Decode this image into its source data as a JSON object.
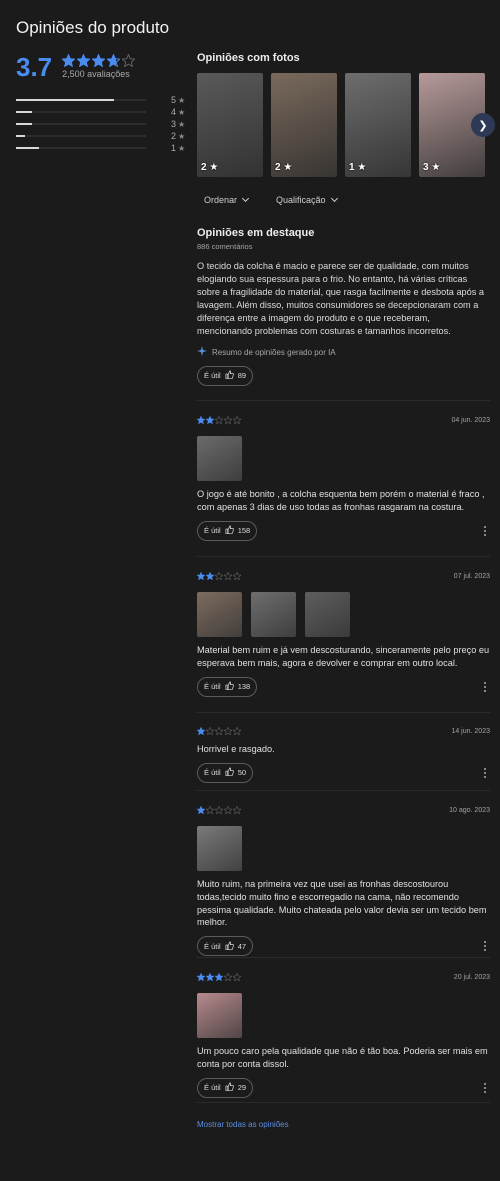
{
  "header": {
    "title": "Opiniões do produto"
  },
  "summary": {
    "average": "3.7",
    "rating": 3.7,
    "total_label": "2,500 avaliações",
    "distribution": [
      {
        "label": "5",
        "fraction": 0.75
      },
      {
        "label": "4",
        "fraction": 0.12
      },
      {
        "label": "3",
        "fraction": 0.12
      },
      {
        "label": "2",
        "fraction": 0.07
      },
      {
        "label": "1",
        "fraction": 0.18
      }
    ]
  },
  "photos_section": {
    "title": "Opiniões com fotos",
    "photos": [
      {
        "rating": "2",
        "tone": "#5a5a5a"
      },
      {
        "rating": "2",
        "tone": "#7a6a5c"
      },
      {
        "rating": "1",
        "tone": "#6e6e6e"
      },
      {
        "rating": "3",
        "tone": "#b79a9a"
      }
    ]
  },
  "filters": {
    "sort_label": "Ordenar",
    "rating_label": "Qualificação"
  },
  "featured": {
    "title": "Opiniões em destaque",
    "comments_count": "886 comentários",
    "ai_summary": "O tecido da colcha é macio e parece ser de qualidade, com muitos elogiando sua espessura para o frio. No entanto, há várias críticas sobre a fragilidade do material, que rasga facilmente e desbota após a lavagem. Além disso, muitos consumidores se decepcionaram com a diferença entre a imagem do produto e o que receberam, mencionando problemas com costuras e tamanhos incorretos.",
    "ai_note": "Resumo de opiniões gerado por IA",
    "useful_label": "É útil",
    "useful_count": "89"
  },
  "reviews": [
    {
      "stars": 2,
      "date": "04 jun. 2023",
      "images": [
        "#6b6b6b"
      ],
      "text": "O jogo é até bonito , a colcha esquenta bem porém o material é fraco , com apenas 3 dias de uso todas as fronhas rasgaram na costura.",
      "useful_label": "É útil",
      "useful_count": "158"
    },
    {
      "stars": 2,
      "date": "07 jul. 2023",
      "images": [
        "#7d6c5f",
        "#6e6e6e",
        "#5e5e5e"
      ],
      "text": "Material bem ruim e já vem descosturando, sinceramente pelo preço eu esperava bem mais, agora e devolver e comprar em outro local.",
      "useful_label": "É útil",
      "useful_count": "138"
    },
    {
      "stars": 1,
      "date": "14 jun. 2023",
      "images": [],
      "text": "Horrivel e rasgado.",
      "useful_label": "É útil",
      "useful_count": "50"
    },
    {
      "stars": 1,
      "date": "10 ago. 2023",
      "images": [
        "#7a7a7a"
      ],
      "text": "Muito ruim, na primeira vez que usei as fronhas descostourou todas,tecido muito fino e escorregadio na cama, não recomendo pessima qualidade. Muito chateada pelo valor devia ser um tecido bem melhor.",
      "useful_label": "É útil",
      "useful_count": "47"
    },
    {
      "stars": 3,
      "date": "20 jul. 2023",
      "images": [
        "#b88a8d"
      ],
      "text": "Um pouco caro pela qualidade que não é tão boa. Poderia ser mais em conta por conta dissol.",
      "useful_label": "É útil",
      "useful_count": "29"
    }
  ],
  "show_all_label": "Mostrar todas as opiniões",
  "colors": {
    "accent": "#4a8cf0",
    "star_empty": "#666666",
    "link": "#5b8fe0"
  }
}
